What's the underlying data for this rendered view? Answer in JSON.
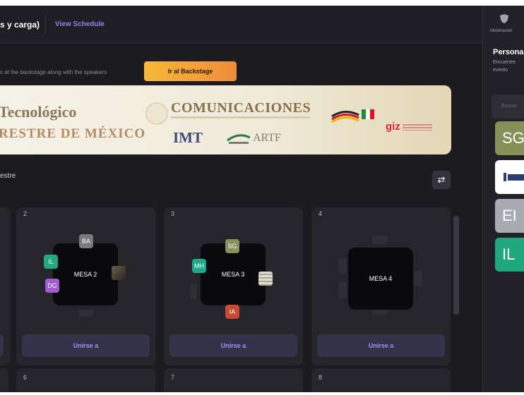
{
  "header": {
    "title": "s y carga)",
    "schedule_link": "View Schedule"
  },
  "backstage": {
    "note": "s at the backstage along with the speakers",
    "button": "Ir al Backstage"
  },
  "banner": {
    "line1": "Tecnológico",
    "line2": "RESTRE DE MÉXICO",
    "ministry": "COMUNICACIONES",
    "logo_imt": "IMT",
    "logo_artf": "ARTF",
    "logo_giz": "giz"
  },
  "section": {
    "label": "estre",
    "filter_icon": "sliders-icon"
  },
  "tables": [
    {
      "number": "2",
      "name": "MESA 2",
      "join": "Unirse a",
      "seats": [
        "BA",
        "IL",
        "DG"
      ]
    },
    {
      "number": "3",
      "name": "MESA 3",
      "join": "Unirse a",
      "seats": [
        "SG",
        "MH",
        "IA"
      ]
    },
    {
      "number": "4",
      "name": "MESA 4",
      "join": "Unirse a",
      "seats": []
    }
  ],
  "bottom_tables": [
    "6",
    "7",
    "8"
  ],
  "side_panel": {
    "moderation_label": "Moderación",
    "title": "Persona",
    "desc_1": "Encuentre",
    "desc_2": "evento",
    "search_placeholder": "Buscar",
    "tiles": [
      "SG",
      "EI",
      "IL"
    ]
  },
  "colors": {
    "accent": "#8f84f0",
    "backstage_btn": "#f6b93b",
    "seat_BA": "#7a7a7a",
    "seat_IL": "#22a87b",
    "seat_DG": "#a15cd1",
    "seat_SG": "#86915a",
    "seat_MH": "#1ea98a",
    "seat_IA": "#c74a32"
  }
}
